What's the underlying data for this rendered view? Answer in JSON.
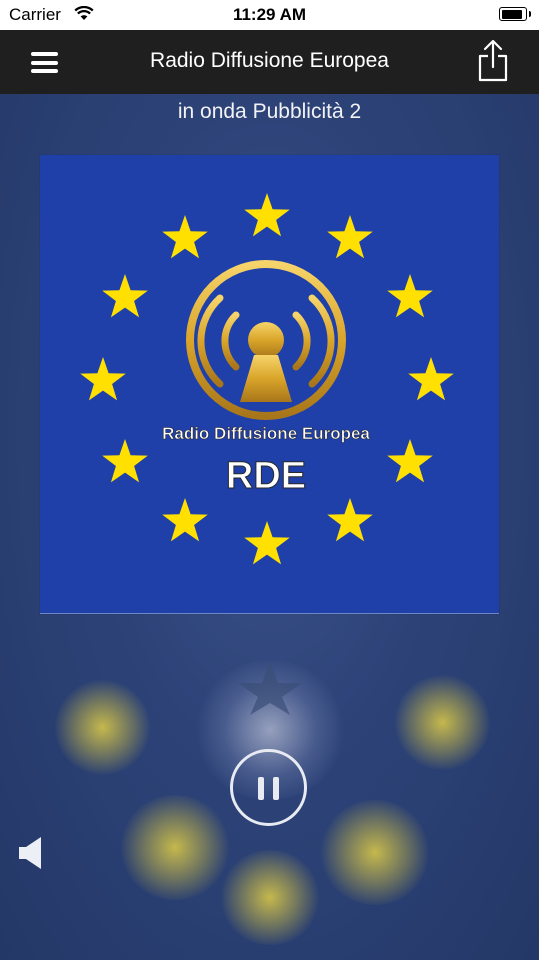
{
  "status_bar": {
    "carrier": "Carrier",
    "time": "11:29 AM",
    "battery_level": 1.0
  },
  "nav": {
    "title": "Radio Diffusione Europea",
    "menu_icon": "hamburger-menu-icon",
    "share_icon": "share-icon"
  },
  "now_playing": {
    "on_air_text": "in onda Pubblicità 2"
  },
  "artwork": {
    "station_name": "Radio Diffusione Europea",
    "station_abbr": "RDE",
    "colors": {
      "background": "#1f3fa9",
      "stars": "#ffe000",
      "emblem": "#d9b13a"
    }
  },
  "controls": {
    "pause_icon": "pause-icon",
    "volume_icon": "volume-icon"
  }
}
